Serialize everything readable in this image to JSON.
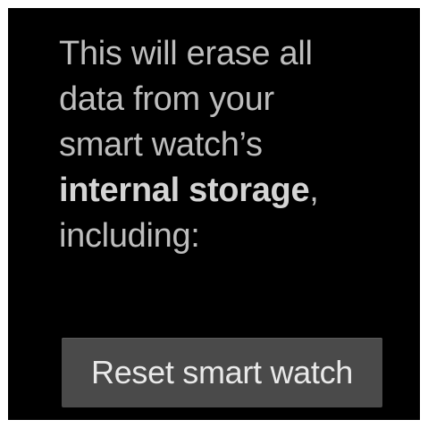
{
  "dialog": {
    "message_line1": "This will erase all",
    "message_line2": "data from your",
    "message_line3": "smart watch’s",
    "message_strong": "internal storage",
    "message_comma": ",",
    "message_line5": "including:",
    "reset_button_label": "Reset smart watch"
  }
}
